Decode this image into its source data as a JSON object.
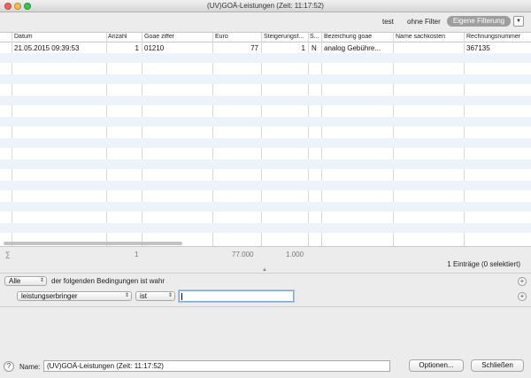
{
  "window": {
    "title": "(UV)GOÄ-Leistungen  (Zeit: 11:17:52)"
  },
  "filterbar": {
    "items": [
      "test",
      "ohne Filter"
    ],
    "custom_filter_label": "Eigene Filterung",
    "dropdown_icon": "chevron-down-icon"
  },
  "table": {
    "columns": [
      "Datum",
      "Anzahl",
      "Goae ziffer",
      "Euro",
      "Steigerungsf...",
      "S...",
      "Bezeichung goae",
      "Name sachkosten",
      "Rechnungsnummer"
    ],
    "rows": [
      [
        "21.05.2015 09:39:53",
        "1",
        "01210",
        "77",
        "1",
        "N",
        "analog Gebühre...",
        "",
        "367135"
      ]
    ]
  },
  "sums": {
    "symbol": "∑",
    "anzahl": "1",
    "euro": "77.000",
    "steigerung": "1.000"
  },
  "status": "1 Einträge (0 selektiert)",
  "conditions": {
    "quantifier": "Alle",
    "text": "der folgenden Bedingungen ist wahr",
    "field": "leistungserbringer",
    "operator": "ist",
    "value": ""
  },
  "bottom": {
    "help": "?",
    "name_label": "Name:",
    "name_value": "(UV)GOÄ-Leistungen  (Zeit: 11:17:52)",
    "options_button": "Optionen...",
    "close_button": "Schließen"
  },
  "colors": {
    "alt_row": "#eef3fa",
    "focus": "#7aa7d8",
    "custom_filter_bg": "#9e9e9e"
  }
}
